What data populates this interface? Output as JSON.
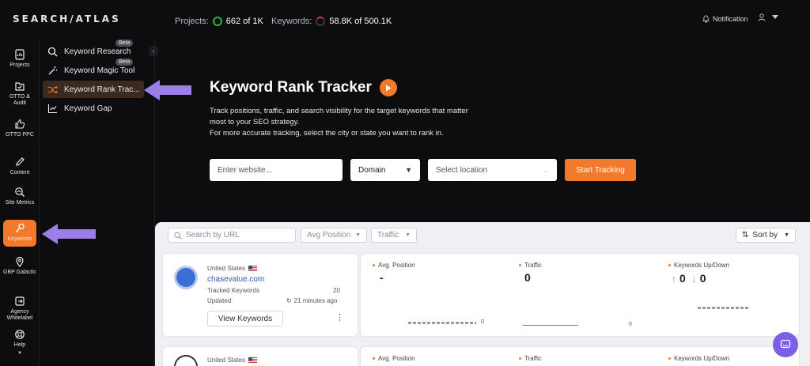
{
  "logo": "SEARCH/ATLAS",
  "topbar": {
    "projects_label": "Projects:",
    "projects_value": "662 of 1K",
    "keywords_label": "Keywords:",
    "keywords_value": "58.8K of 500.1K",
    "notification_label": "Notification"
  },
  "rail": [
    {
      "label": "Projects",
      "icon": "projects-icon"
    },
    {
      "label": "OTTO & Audit",
      "icon": "audit-icon"
    },
    {
      "label": "OTTO PPC",
      "icon": "thumbs-up-icon"
    },
    {
      "label": "Content",
      "icon": "pen-icon"
    },
    {
      "label": "Site Metrics",
      "icon": "site-metrics-icon"
    },
    {
      "label": "Keywords",
      "icon": "key-icon"
    },
    {
      "label": "GBP Galactic",
      "icon": "map-pin-icon"
    },
    {
      "label": "Agency Whitelabel",
      "icon": "agency-icon"
    },
    {
      "label": "Help",
      "icon": "help-icon"
    }
  ],
  "submenu": [
    {
      "label": "Keyword Research",
      "icon": "search-icon",
      "badge": "Beta"
    },
    {
      "label": "Keyword Magic Tool",
      "icon": "magic-wand-icon",
      "badge": "Beta"
    },
    {
      "label": "Keyword Rank Trac...",
      "icon": "shuffle-icon",
      "badge": ""
    },
    {
      "label": "Keyword Gap",
      "icon": "chart-icon",
      "badge": ""
    }
  ],
  "hero": {
    "title": "Keyword Rank Tracker",
    "desc_line1": "Track positions, traffic, and search visibility for the target keywords that matter most to your SEO strategy.",
    "desc_line2": "For more accurate tracking, select the city or state you want to rank in.",
    "website_placeholder": "Enter website...",
    "domain_value": "Domain",
    "location_placeholder": "Select location",
    "start_button": "Start Tracking"
  },
  "filters": {
    "search_placeholder": "Search by URL",
    "avg_position": "Avg Position",
    "traffic": "Traffic",
    "sort_by": "Sort by"
  },
  "rows": [
    {
      "country": "United States",
      "domain": "chasevalue.com",
      "tracked_label": "Tracked Keywords",
      "tracked_value": "20",
      "updated_label": "Updated",
      "updated_value": "21 minutes ago",
      "view_button": "View Keywords",
      "avg_position_label": "Avg. Position",
      "avg_position_value": "-",
      "traffic_label": "Traffic",
      "traffic_value": "0",
      "kw_updown_label": "Keywords Up/Down",
      "kw_up": "0",
      "kw_down": "0",
      "chart_zero_1": "0",
      "chart_zero_2": "0"
    },
    {
      "country": "United States",
      "avg_position_label": "Avg. Position",
      "traffic_label": "Traffic",
      "kw_updown_label": "Keywords Up/Down"
    }
  ],
  "colors": {
    "accent": "#f47a2b",
    "highlight_arrow": "#9b7fe6",
    "link": "#2a5db0"
  }
}
